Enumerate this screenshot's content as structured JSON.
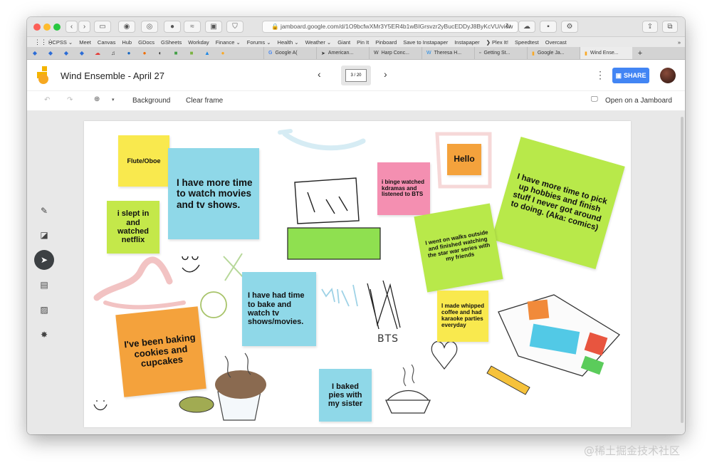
{
  "browser": {
    "url": "jamboard.google.com/d/1O9bcfwXMr3Y5ER4b1wBIGrsvzr2yBucEDDyJ8ByKcVU/view",
    "bookmarks": [
      "HCPSS ⌄",
      "Meet",
      "Canvas",
      "Hub",
      "GDocs",
      "GSheets",
      "Workday",
      "Finance ⌄",
      "Forums ⌄",
      "Health ⌄",
      "Weather ⌄",
      "Giant",
      "Pin It",
      "Pinboard",
      "Save to Instapaper",
      "Instapaper",
      "❯ Plex It!",
      "Speedtest",
      "Overcast"
    ],
    "tabs": [
      "Google A(",
      "American...",
      "Harp Conc...",
      "Theresa H...",
      "Getting St...",
      "Google Ja...",
      "Wind Ense..."
    ]
  },
  "app": {
    "title": "Wind Ensemble - April 27",
    "frame": "3 / 20",
    "share": "SHARE"
  },
  "toolbar": {
    "background": "Background",
    "clear": "Clear frame",
    "open_jam": "Open on a Jamboard"
  },
  "notes": {
    "flute": "Flute/Oboe",
    "movies": "I have more time to watch movies and tv shows.",
    "slept": "i slept in and watched netflix",
    "baking": "I've been baking cookies and cupcakes",
    "bake_watch": "I have had time to bake and watch tv shows/movies.",
    "pies": "I baked pies with my sister",
    "kdramas": "i binge watched kdramas and listened to BTS",
    "hello": "Hello",
    "walks": "I went on walks outside and finished watching the star war series with my friends",
    "hobbies": "I have more time to pick up hobbies and finish stuff I never got around to doing. (Aka: comics)",
    "coffee": "I made whipped coffee and had karaoke parties everyday"
  },
  "drawings": {
    "bts": "BTS"
  },
  "watermark": "@稀土掘金技术社区",
  "colors": {
    "yellow": "#f9e94e",
    "blue": "#8fd8e8",
    "green": "#c4e84a",
    "orange": "#f4a23c",
    "pink": "#f48fb1",
    "share": "#4285f4"
  }
}
